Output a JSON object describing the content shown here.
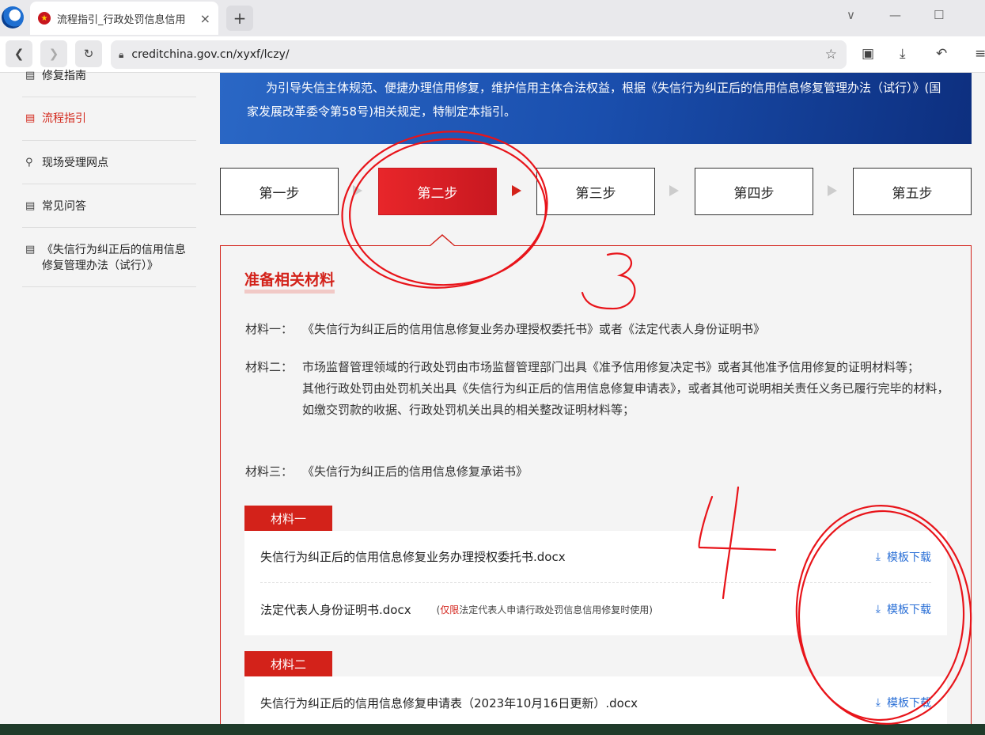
{
  "browser": {
    "tab_title": "流程指引_行政处罚信息信用",
    "tab_close": "×",
    "new_tab": "+",
    "url": "creditchina.gov.cn/xyxf/lczy/",
    "window_controls": [
      "∨",
      "—",
      "☐"
    ]
  },
  "sidebar": {
    "items": [
      {
        "label": "修复指南",
        "icon": "document-icon",
        "active": false
      },
      {
        "label": "流程指引",
        "icon": "document-icon",
        "active": true
      },
      {
        "label": "现场受理网点",
        "icon": "search-icon",
        "active": false
      },
      {
        "label": "常见问答",
        "icon": "document-icon",
        "active": false
      },
      {
        "label": "《失信行为纠正后的信用信息修复管理办法（试行）》",
        "icon": "document-icon",
        "active": false
      }
    ]
  },
  "banner": {
    "text": "为引导失信主体规范、便捷办理信用修复，维护信用主体合法权益，根据《失信行为纠正后的信用信息修复管理办法（试行）》(国家发展改革委令第58号)相关规定，特制定本指引。"
  },
  "steps": [
    "第一步",
    "第二步",
    "第三步",
    "第四步",
    "第五步"
  ],
  "active_step": 2,
  "section": {
    "title": "准备相关材料",
    "materials": [
      {
        "key": "材料一：",
        "lines": [
          "《失信行为纠正后的信用信息修复业务办理授权委托书》或者《法定代表人身份证明书》"
        ]
      },
      {
        "key": "材料二：",
        "lines": [
          "市场监督管理领域的行政处罚由市场监督管理部门出具《准予信用修复决定书》或者其他准予信用修复的证明材料等；",
          "其他行政处罚由处罚机关出具《失信行为纠正后的信用信息修复申请表》，或者其他可说明相关责任义务已履行完毕的材料，如缴交罚款的收据、行政处罚机关出具的相关整改证明材料等；"
        ]
      },
      {
        "key": "材料三：",
        "lines": [
          "《失信行为纠正后的信用信息修复承诺书》"
        ]
      }
    ]
  },
  "downloads": [
    {
      "tag": "材料一",
      "files": [
        {
          "name": "失信行为纠正后的信用信息修复业务办理授权委托书.docx",
          "note_prefix": "",
          "note_highlight": "",
          "note_rest": "",
          "action": "模板下载"
        },
        {
          "name": "法定代表人身份证明书.docx",
          "note_prefix": "(",
          "note_highlight": "仅限",
          "note_rest": "法定代表人申请行政处罚信息信用修复时使用)",
          "action": "模板下载"
        }
      ]
    },
    {
      "tag": "材料二",
      "files": [
        {
          "name": "失信行为纠正后的信用信息修复申请表（2023年10月16日更新）.docx",
          "action": "模板下载"
        }
      ]
    }
  ],
  "colors": {
    "accent": "#d3221a",
    "link": "#2a6fd6",
    "banner": "#1a4fae"
  },
  "handwriting": [
    "3",
    "4"
  ]
}
